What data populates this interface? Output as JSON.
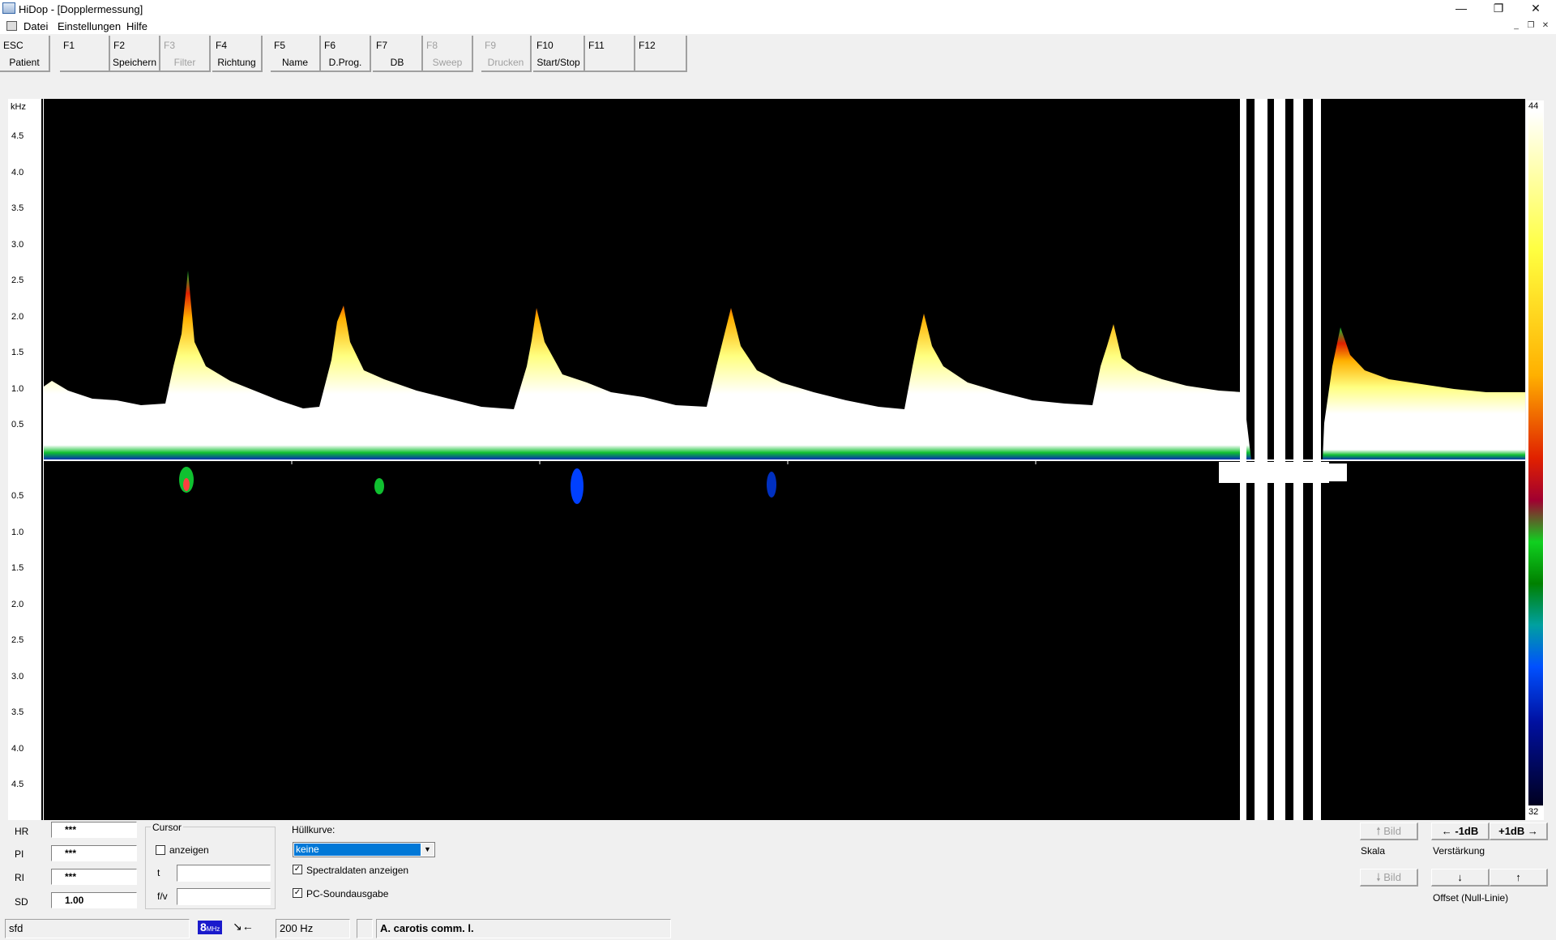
{
  "window": {
    "title": "HiDop - [Dopplermessung]",
    "minimize": "—",
    "restore": "❐",
    "close": "✕"
  },
  "menu": {
    "items": [
      "Datei",
      "Einstellungen",
      "Hilfe"
    ],
    "mdi_minimize": "_",
    "mdi_restore": "❐",
    "mdi_close": "✕"
  },
  "toolbar": {
    "keys": [
      {
        "key": "ESC",
        "label": "Patient",
        "enabled": true
      },
      {
        "key": "F1",
        "label": "",
        "enabled": true
      },
      {
        "key": "F2",
        "label": "Speichern",
        "enabled": true
      },
      {
        "key": "F3",
        "label": "Filter",
        "enabled": false
      },
      {
        "key": "F4",
        "label": "Richtung",
        "enabled": true
      },
      {
        "key": "F5",
        "label": "Name",
        "enabled": true
      },
      {
        "key": "F6",
        "label": "D.Prog.",
        "enabled": true
      },
      {
        "key": "F7",
        "label": "DB",
        "enabled": true
      },
      {
        "key": "F8",
        "label": "Sweep",
        "enabled": false
      },
      {
        "key": "F9",
        "label": "Drucken",
        "enabled": false
      },
      {
        "key": "F10",
        "label": "Start/Stop",
        "enabled": true
      },
      {
        "key": "F11",
        "label": "",
        "enabled": true
      },
      {
        "key": "F12",
        "label": "",
        "enabled": true
      }
    ]
  },
  "spectrum": {
    "unit": "kHz",
    "upper_ticks": [
      "4.5",
      "4.0",
      "3.5",
      "3.0",
      "2.5",
      "2.0",
      "1.5",
      "1.0",
      "0.5"
    ],
    "lower_ticks": [
      "0.5",
      "1.0",
      "1.5",
      "2.0",
      "2.5",
      "3.0",
      "3.5",
      "4.0",
      "4.5"
    ],
    "colorbar_max": "44",
    "colorbar_min": "32"
  },
  "params": {
    "hr_label": "HR",
    "hr_value": "***",
    "pi_label": "PI",
    "pi_value": "***",
    "ri_label": "RI",
    "ri_value": "***",
    "sd_label": "SD",
    "sd_value": "1.00"
  },
  "cursor": {
    "title": "Cursor",
    "show_label": "anzeigen",
    "show_checked": false,
    "t_label": "t",
    "t_value": "",
    "fv_label": "f/v",
    "fv_value": ""
  },
  "envelope": {
    "label": "Hüllkurve:",
    "selected": "keine",
    "spectral_label": "Spectraldaten anzeigen",
    "spectral_checked": true,
    "sound_label": "PC-Soundausgabe",
    "sound_checked": true
  },
  "controls": {
    "scale_up": "🠕 Bild",
    "scale_down": "🠗 Bild",
    "scale_label": "Skala",
    "gain_down": "← -1dB",
    "gain_up": "+1dB →",
    "gain_label": "Verstärkung",
    "offset_down": "↓",
    "offset_up": "↑",
    "offset_label": "Offset (Null-Linie)"
  },
  "status": {
    "name": "sfd",
    "probe": "8",
    "probe_unit": "MHz",
    "direction_glyph": "↘←",
    "prf": "200 Hz",
    "vessel": "A. carotis comm. l."
  }
}
